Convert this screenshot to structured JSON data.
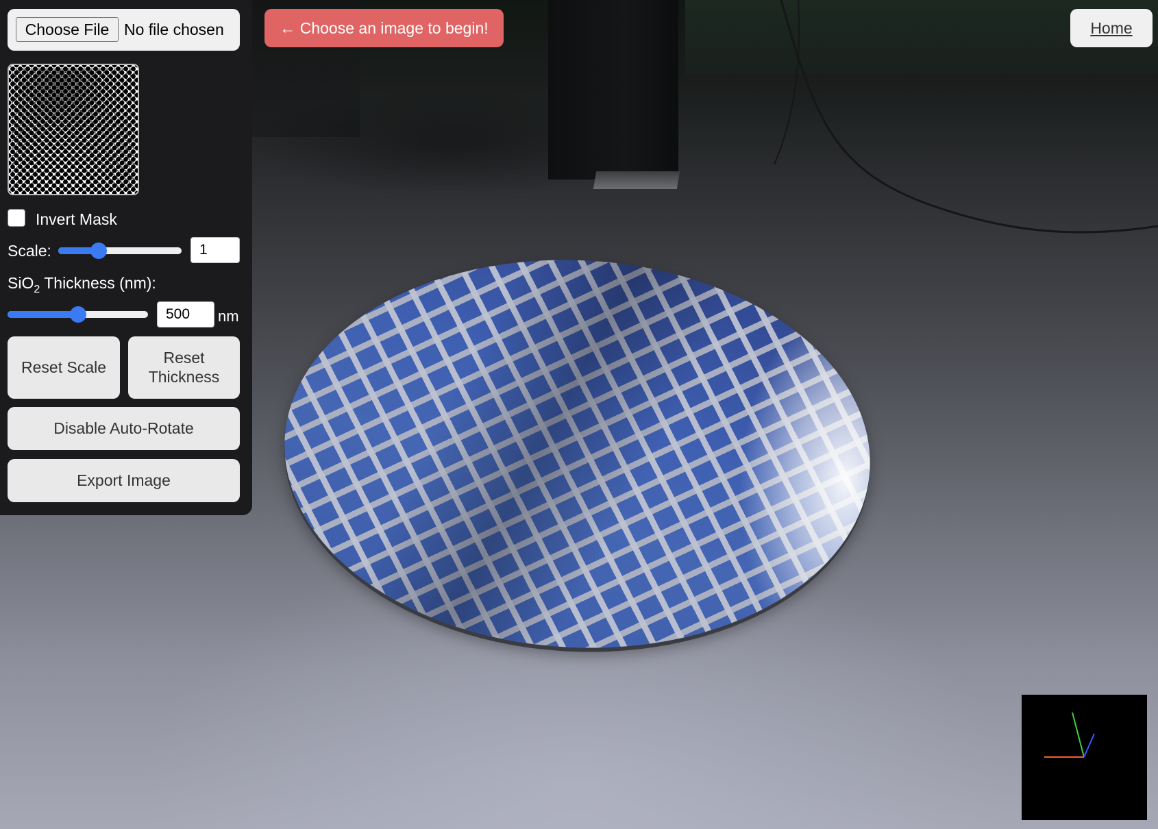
{
  "file_input": {
    "button_label": "Choose File",
    "status": "No file chosen"
  },
  "banner": {
    "text": "← Choose an image to begin!"
  },
  "nav": {
    "home_label": "Home"
  },
  "controls": {
    "invert_mask": {
      "label": "Invert Mask",
      "checked": false
    },
    "scale": {
      "label": "Scale:",
      "value": "1",
      "slider_fraction": 0.33
    },
    "thickness": {
      "label_prefix": "SiO",
      "label_sub": "2",
      "label_suffix": " Thickness (nm):",
      "value": "500",
      "unit": "nm",
      "slider_fraction": 0.5
    },
    "reset_scale_label": "Reset Scale",
    "reset_thickness_label": "Reset Thickness",
    "auto_rotate_label": "Disable Auto-Rotate",
    "export_label": "Export Image"
  },
  "colors": {
    "accent": "#3a7af2",
    "banner": "#e06464",
    "panel": "#1b1b1d",
    "axis_x": "#ff5a2a",
    "axis_y": "#3fcf3f",
    "axis_z": "#3a5cff"
  },
  "icons": {
    "arrow": "left-arrow-icon"
  }
}
